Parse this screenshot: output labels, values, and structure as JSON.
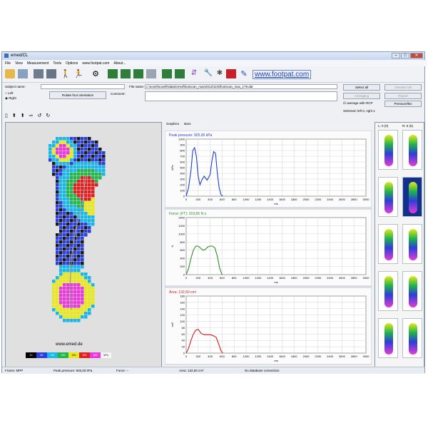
{
  "window": {
    "title": "emed/CL"
  },
  "menu": [
    "File",
    "View",
    "Measurement",
    "Tools",
    "Options",
    "www.footpat.com",
    "About..."
  ],
  "toolbar": {
    "link": "www.footpat.com"
  },
  "subject": {
    "label": "Subject name:",
    "value": "",
    "side_left": "Left",
    "side_right": "Right",
    "rotate_button": "Rotate foot orientation"
  },
  "file": {
    "label": "File name:",
    "value": "c:\\novel\\novellr\\data\\emed\\footscan_max\\2012\\11\\5\\footscan_max_179.dat",
    "comment_label": "Comment:"
  },
  "right_buttons": {
    "select_all": "Select all",
    "deselect_all": "Deselect all",
    "averaging": "Averaging",
    "report": "Report",
    "pressureflex": "Pressureflex",
    "avg_rcp": "average with RCP",
    "selected": "Selected: left 0, right 1"
  },
  "tabs": {
    "graphics": "Graphics",
    "bars": "Bars"
  },
  "colors": {
    "blue": "#1f3fd0",
    "green": "#2e8b2e",
    "red": "#cc1e1e"
  },
  "chart_data": [
    {
      "type": "line",
      "title": "Peak pressure: 925,00 kPa",
      "ylabel": "kPa",
      "xlabel": "ms",
      "ylim": [
        0,
        1000
      ],
      "yticks": [
        0,
        100,
        200,
        300,
        400,
        500,
        600,
        700,
        800,
        900,
        1000
      ],
      "xticks": [
        0,
        200,
        400,
        600,
        800,
        1000,
        1200,
        1400,
        1600,
        1800,
        2000,
        2200,
        2400,
        2600,
        2800,
        3000
      ],
      "series": [
        {
          "x": [
            0,
            40,
            80,
            110,
            140,
            170,
            200,
            230,
            260,
            300,
            350,
            400,
            430,
            460,
            490,
            520,
            550,
            580,
            610
          ],
          "values": [
            0,
            150,
            450,
            800,
            850,
            700,
            350,
            200,
            280,
            350,
            280,
            380,
            620,
            780,
            750,
            400,
            150,
            30,
            0
          ]
        }
      ]
    },
    {
      "type": "line",
      "title": "Force:  (FT): 319,65 N s",
      "ylabel": "N",
      "xlabel": "ms",
      "ylim": [
        0,
        1400
      ],
      "yticks": [
        0,
        200,
        400,
        600,
        800,
        1000,
        1200,
        1400
      ],
      "xticks": [
        0,
        200,
        400,
        600,
        800,
        1000,
        1200,
        1400,
        1600,
        1800,
        2000,
        2200,
        2400,
        2600,
        2800,
        3000
      ],
      "series": [
        {
          "x": [
            0,
            40,
            80,
            120,
            160,
            200,
            240,
            280,
            320,
            360,
            400,
            440,
            480,
            520,
            560,
            600
          ],
          "values": [
            0,
            150,
            400,
            600,
            700,
            700,
            650,
            600,
            620,
            680,
            700,
            700,
            650,
            450,
            150,
            0
          ]
        }
      ]
    },
    {
      "type": "line",
      "title": "Area: 132,50 cm²",
      "ylabel": "cm²",
      "xlabel": "ms",
      "ylim": [
        0,
        180
      ],
      "yticks": [
        0,
        20,
        40,
        60,
        80,
        100,
        120,
        140,
        160,
        180
      ],
      "xticks": [
        0,
        200,
        400,
        600,
        800,
        1000,
        1200,
        1400,
        1600,
        1800,
        2000,
        2200,
        2400,
        2600,
        2800,
        3000
      ],
      "series": [
        {
          "x": [
            0,
            40,
            80,
            120,
            160,
            200,
            250,
            300,
            350,
            400,
            450,
            500,
            540,
            580,
            610
          ],
          "values": [
            0,
            15,
            40,
            60,
            72,
            75,
            62,
            58,
            58,
            58,
            55,
            50,
            30,
            8,
            0
          ]
        }
      ]
    }
  ],
  "side_pane": {
    "left_header": "L: 0 (0)",
    "right_header": "R: 5 (5)"
  },
  "footer_brand": "www.emed.de",
  "legend": [
    "10",
    "50",
    "100",
    "150",
    "200",
    "300",
    "400",
    "kPa"
  ],
  "status": {
    "frame": "Frame: MPP",
    "pressure": "Peak pressure: 925,00 kPa",
    "force": "Force: --",
    "area": "Area: 132,50 cm²",
    "db": "No database connection"
  }
}
